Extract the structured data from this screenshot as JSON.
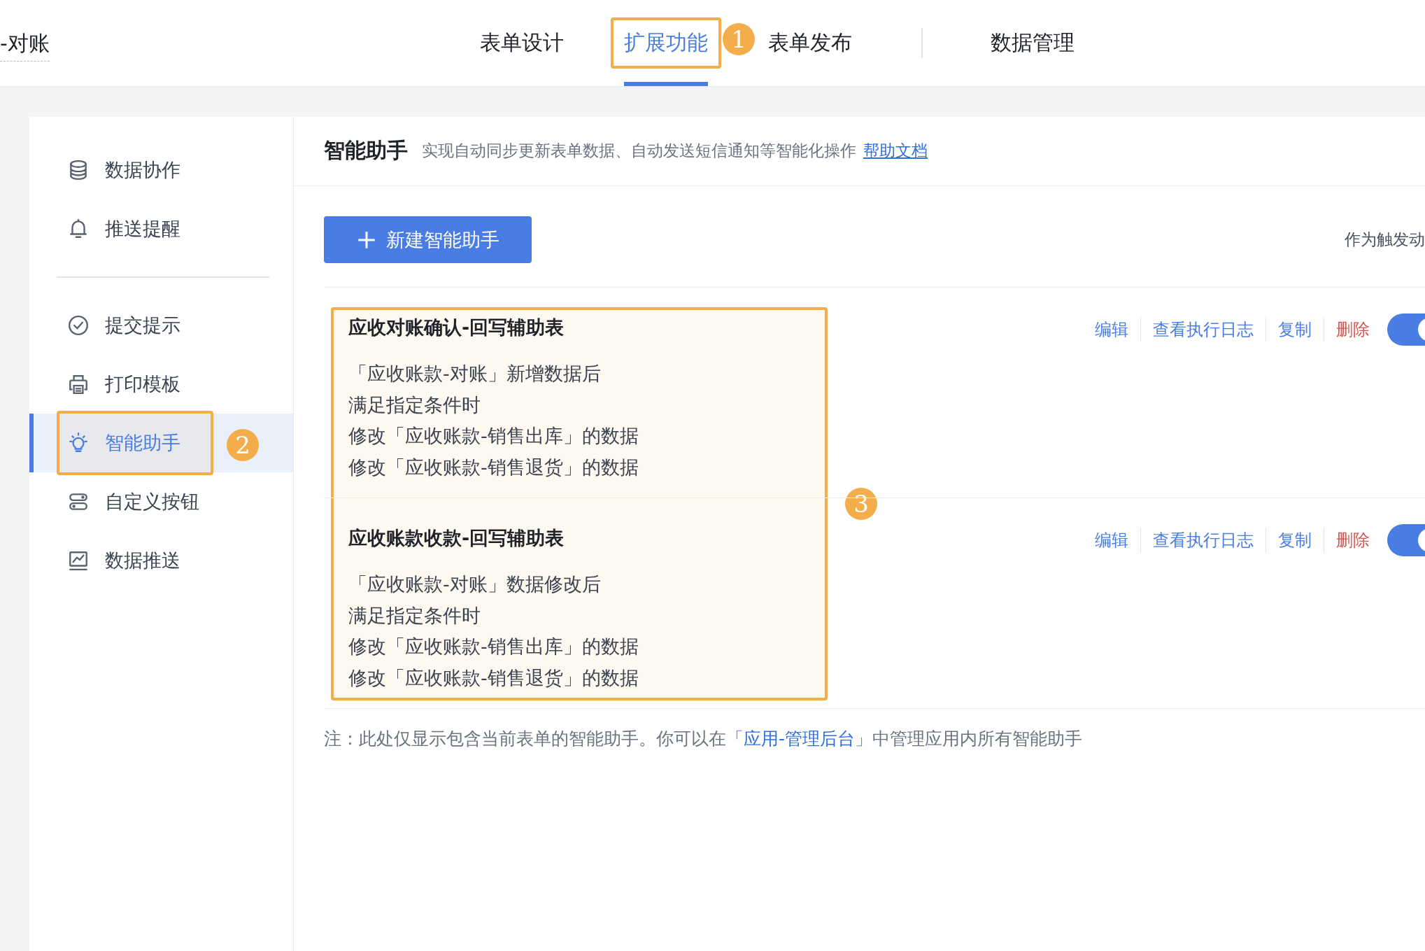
{
  "header": {
    "form_title": "-对账",
    "tabs": [
      {
        "label": "表单设计",
        "selected": false
      },
      {
        "label": "扩展功能",
        "selected": true
      },
      {
        "label": "表单发布",
        "selected": false
      },
      {
        "label": "数据管理",
        "selected": false
      }
    ]
  },
  "sidebar": {
    "groups": [
      [
        {
          "label": "数据协作",
          "selected": false
        },
        {
          "label": "推送提醒",
          "selected": false
        }
      ],
      [
        {
          "label": "提交提示",
          "selected": false
        },
        {
          "label": "打印模板",
          "selected": false
        },
        {
          "label": "智能助手",
          "selected": true
        },
        {
          "label": "自定义按钮",
          "selected": false
        },
        {
          "label": "数据推送",
          "selected": false
        }
      ]
    ]
  },
  "main": {
    "title": "智能助手",
    "description": "实现自动同步更新表单数据、自动发送短信通知等智能化操作",
    "help_link": "帮助文档",
    "new_button": "新建智能助手",
    "trigger_label": "作为触发动",
    "assistants": [
      {
        "title": "应收对账确认-回写辅助表",
        "lines": [
          "「应收账款-对账」新增数据后",
          "满足指定条件时",
          "修改「应收账款-销售出库」的数据",
          "修改「应收账款-销售退货」的数据"
        ],
        "actions": [
          {
            "label": "编辑",
            "kind": "link"
          },
          {
            "label": "查看执行日志",
            "kind": "link"
          },
          {
            "label": "复制",
            "kind": "link"
          },
          {
            "label": "删除",
            "kind": "danger"
          }
        ],
        "on": true
      },
      {
        "title": "应收账款收款-回写辅助表",
        "lines": [
          "「应收账款-对账」数据修改后",
          "满足指定条件时",
          "修改「应收账款-销售出库」的数据",
          "修改「应收账款-销售退货」的数据"
        ],
        "actions": [
          {
            "label": "编辑",
            "kind": "link"
          },
          {
            "label": "查看执行日志",
            "kind": "link"
          },
          {
            "label": "复制",
            "kind": "link"
          },
          {
            "label": "删除",
            "kind": "danger"
          }
        ],
        "on": true
      }
    ],
    "note": {
      "before": "注：此处仅显示包含当前表单的智能助手。你可以在",
      "link": "「应用-管理后台」",
      "after": "中管理应用内所有智能助手"
    }
  },
  "badges": [
    "1",
    "2",
    "3"
  ]
}
